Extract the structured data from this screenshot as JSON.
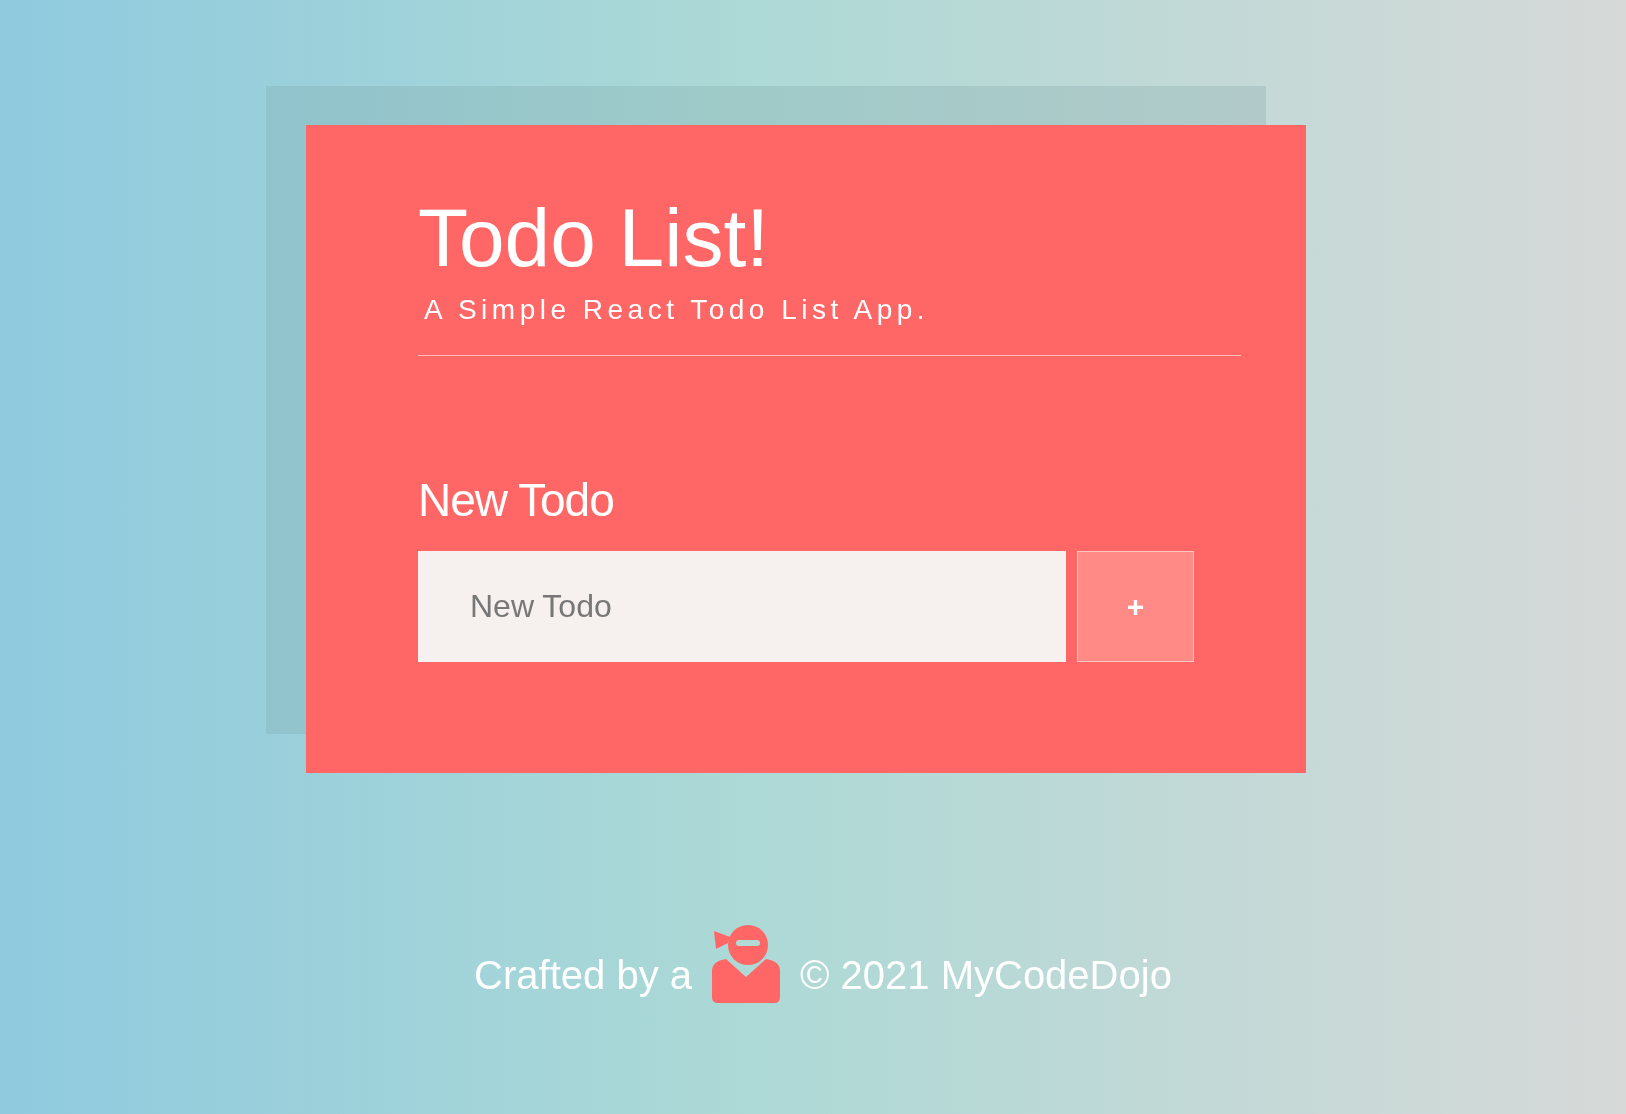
{
  "header": {
    "title": "Todo List!",
    "subtitle": "A Simple React Todo List App."
  },
  "form": {
    "label": "New Todo",
    "placeholder": "New Todo",
    "button": "+"
  },
  "footer": {
    "prefix": "Crafted by a",
    "suffix": "© 2021 MyCodeDojo"
  }
}
